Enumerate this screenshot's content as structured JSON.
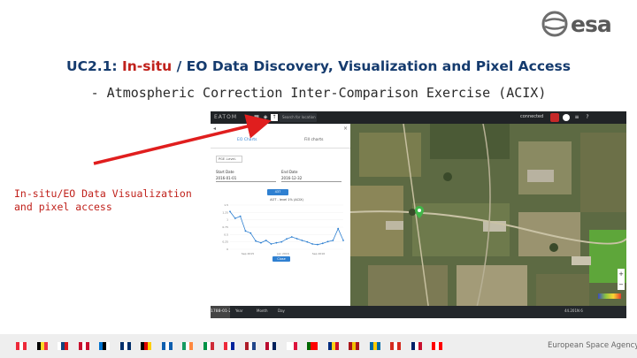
{
  "logo": {
    "word": "esa"
  },
  "title": {
    "prefix": "UC2.1: ",
    "highlight": "In-situ",
    "suffix": " / EO Data Discovery, Visualization and Pixel Access"
  },
  "subtitle": "- Atmospheric Correction Inter-Comparison Exercise (ACIX)",
  "caption": "In-situ/EO Data Visualization and pixel access",
  "screenshot": {
    "topbar": {
      "logo": "EATOM",
      "search": "Search for location",
      "account": "connected",
      "icons": [
        "grid-icon",
        "layers-icon",
        "upload-icon"
      ]
    },
    "panel": {
      "tabs": [
        "EO Charts",
        "Fill charts"
      ],
      "select": "PGE -Level-",
      "start_label": "Start Date",
      "start_value": "2016-01-01",
      "end_label": "End Date",
      "end_value": "2016-12-32",
      "range_label": "437",
      "chart_title": "AOT - level 1% (ACIX)",
      "yticks": [
        "1.5",
        "1.25",
        "1",
        "0.75",
        "0.5",
        "0.25",
        "0"
      ],
      "xticks": [
        "Sep 2015",
        "Jan 2016",
        "Sep 2016"
      ],
      "button": "Close"
    },
    "timeline": {
      "date": "1788-01-22",
      "items": [
        "Year",
        "Month",
        "Day"
      ],
      "coords": "44.201N 6"
    }
  },
  "chart_data": {
    "type": "line",
    "title": "AOT - level 1% (ACIX)",
    "x": [
      0,
      1,
      2,
      3,
      4,
      5,
      6,
      7,
      8,
      9,
      10,
      11,
      12,
      13,
      14,
      15,
      16,
      17,
      18,
      19,
      20,
      21,
      22
    ],
    "values": [
      1.28,
      1.05,
      1.12,
      0.62,
      0.55,
      0.28,
      0.22,
      0.3,
      0.18,
      0.22,
      0.25,
      0.35,
      0.42,
      0.36,
      0.3,
      0.25,
      0.18,
      0.16,
      0.2,
      0.26,
      0.3,
      0.7,
      0.3
    ],
    "ylim": [
      0,
      1.5
    ]
  },
  "footer": {
    "agency": "European Space Agency",
    "flags": [
      [
        "#ed2939",
        "#ffffff",
        "#ed2939"
      ],
      [
        "#000000",
        "#fdda24",
        "#ef3340"
      ],
      [
        "#ffffff",
        "#11457e",
        "#d7141a"
      ],
      [
        "#c8102e",
        "#ffffff",
        "#c8102e"
      ],
      [
        "#0072ce",
        "#000000",
        "#ffffff"
      ],
      [
        "#002f6c",
        "#ffffff",
        "#002f6c"
      ],
      [
        "#000000",
        "#dd0000",
        "#ffce00"
      ],
      [
        "#0d5eaf",
        "#ffffff",
        "#0d5eaf"
      ],
      [
        "#169b62",
        "#ffffff",
        "#ff883e"
      ],
      [
        "#009246",
        "#ffffff",
        "#ce2b37"
      ],
      [
        "#ed2939",
        "#ffffff",
        "#00239c"
      ],
      [
        "#ae1c28",
        "#ffffff",
        "#21468b"
      ],
      [
        "#ba0c2f",
        "#ffffff",
        "#00205b"
      ],
      [
        "#ffffff",
        "#ffffff",
        "#dc143c"
      ],
      [
        "#006600",
        "#ff0000",
        "#ff0000"
      ],
      [
        "#002b7f",
        "#fcd116",
        "#ce1126"
      ],
      [
        "#aa151b",
        "#f1bf00",
        "#aa151b"
      ],
      [
        "#006aa7",
        "#fecc00",
        "#006aa7"
      ],
      [
        "#d52b1e",
        "#ffffff",
        "#d52b1e"
      ],
      [
        "#012169",
        "#ffffff",
        "#c8102e"
      ],
      [
        "#ff0000",
        "#ffffff",
        "#ff0000"
      ]
    ]
  }
}
